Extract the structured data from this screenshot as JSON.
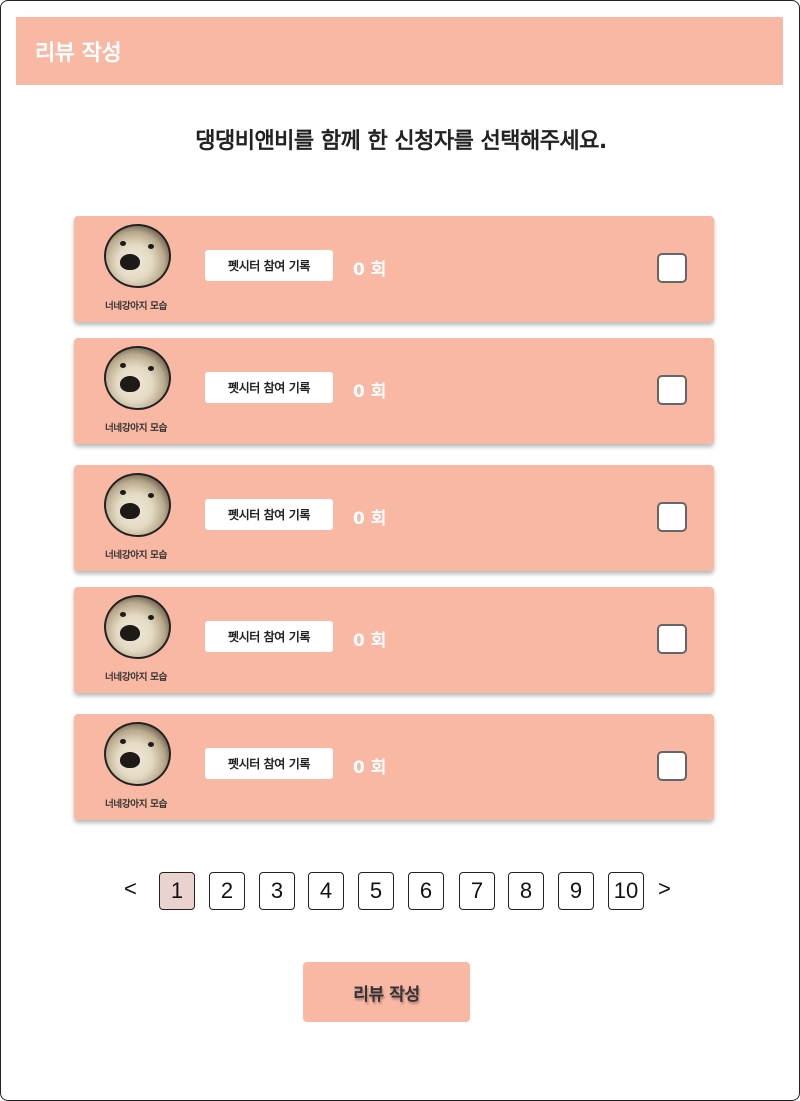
{
  "header": {
    "title": "리뷰 작성"
  },
  "main": {
    "subtitle": "댕댕비앤비를 함께 한 신청자를 선택해주세요.",
    "cards": [
      {
        "caption": "너네강아지 모습",
        "record_label": "펫시터 참여 기록",
        "count": "0 회",
        "checked": false
      },
      {
        "caption": "너네강아지 모습",
        "record_label": "펫시터 참여 기록",
        "count": "0 회",
        "checked": false
      },
      {
        "caption": "너네강아지 모습",
        "record_label": "펫시터 참여 기록",
        "count": "0 회",
        "checked": false
      },
      {
        "caption": "너네강아지 모습",
        "record_label": "펫시터 참여 기록",
        "count": "0 회",
        "checked": false
      },
      {
        "caption": "너네강아지 모습",
        "record_label": "펫시터 참여 기록",
        "count": "0 회",
        "checked": false
      }
    ]
  },
  "pagination": {
    "prev": "<",
    "next": ">",
    "pages": [
      "1",
      "2",
      "3",
      "4",
      "5",
      "6",
      "7",
      "8",
      "9",
      "10"
    ],
    "current": "1"
  },
  "footer": {
    "submit_label": "리뷰 작성"
  },
  "colors": {
    "accent": "#f9b8a4",
    "active_page": "#ead2cf"
  }
}
